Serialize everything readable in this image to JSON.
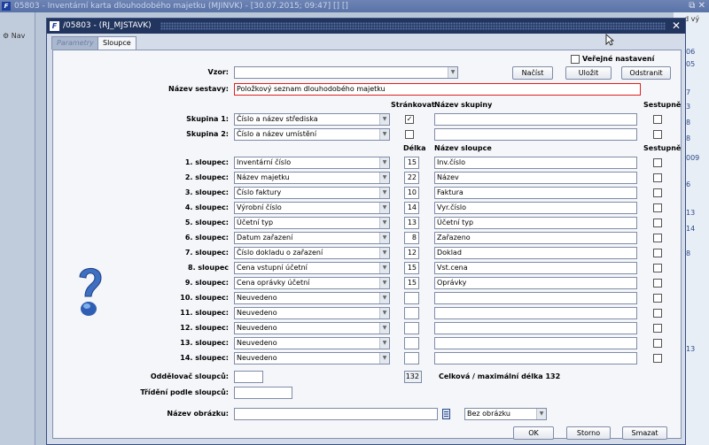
{
  "background": {
    "window_title": "05803 - Inventární karta dlouhodobého majetku (MJINVK) - [30.07.2015; 09:47] [] []",
    "nav_label": "Nav",
    "right_header": "d vý",
    "right_cells": [
      "06",
      "05",
      "7",
      "3",
      "8",
      "8",
      "009",
      "6",
      "13",
      "14",
      "8",
      "13"
    ]
  },
  "dialog": {
    "title": "/05803 - (RJ_MJSTAVK)",
    "tabs": [
      "Parametry",
      "Sloupce"
    ],
    "verejne_label": "Veřejné nastavení",
    "vzor_label": "Vzor:",
    "vzor_value": "",
    "buttons": {
      "nacist": "Načíst",
      "ulozit": "Uložit",
      "odstranit": "Odstranit",
      "ok": "OK",
      "storno": "Storno",
      "smazat": "Smazat"
    },
    "nazev_sestavy_label": "Název sestavy:",
    "nazev_sestavy_value": "Položkový seznam dlouhodobého majetku",
    "headers": {
      "strankovat": "Stránkovat",
      "nazev_skupiny": "Název skupiny",
      "sestupne": "Sestupně",
      "delka": "Délka",
      "nazev_sloupce": "Název sloupce",
      "sestupne2": "Sestupně"
    },
    "groups": [
      {
        "label": "Skupina 1:",
        "value": "Číslo a název střediska",
        "strankovat": true,
        "nazev": "",
        "sestupne": false
      },
      {
        "label": "Skupina 2:",
        "value": "Číslo a název umístění",
        "strankovat": false,
        "nazev": "",
        "sestupne": false
      }
    ],
    "columns": [
      {
        "label": "1. sloupec:",
        "value": "Inventární číslo",
        "delka": "15",
        "nazev": "Inv.číslo"
      },
      {
        "label": "2. sloupec:",
        "value": "Název majetku",
        "delka": "22",
        "nazev": "Název"
      },
      {
        "label": "3. sloupec:",
        "value": "Číslo faktury",
        "delka": "10",
        "nazev": "Faktura"
      },
      {
        "label": "4. sloupec:",
        "value": "Výrobní číslo",
        "delka": "14",
        "nazev": "Vyr.číslo"
      },
      {
        "label": "5. sloupec:",
        "value": "Účetní typ",
        "delka": "13",
        "nazev": "Účetní typ"
      },
      {
        "label": "6. sloupec:",
        "value": "Datum zařazení",
        "delka": "8",
        "nazev": "Zařazeno"
      },
      {
        "label": "7. sloupec:",
        "value": "Číslo dokladu o zařazení",
        "delka": "12",
        "nazev": "Doklad"
      },
      {
        "label": "8. sloupec",
        "value": "Cena vstupní účetní",
        "delka": "15",
        "nazev": "Vst.cena"
      },
      {
        "label": "9. sloupec:",
        "value": "Cena oprávky účetní",
        "delka": "15",
        "nazev": "Oprávky"
      },
      {
        "label": "10. sloupec:",
        "value": "Neuvedeno",
        "delka": "",
        "nazev": ""
      },
      {
        "label": "11. sloupec:",
        "value": "Neuvedeno",
        "delka": "",
        "nazev": ""
      },
      {
        "label": "12. sloupec:",
        "value": "Neuvedeno",
        "delka": "",
        "nazev": ""
      },
      {
        "label": "13. sloupec:",
        "value": "Neuvedeno",
        "delka": "",
        "nazev": ""
      },
      {
        "label": "14. sloupec:",
        "value": "Neuvedeno",
        "delka": "",
        "nazev": ""
      }
    ],
    "oddelovac_label": "Oddělovač sloupců:",
    "oddelovac_value": "",
    "total_value": "132",
    "total_label": "Celková / maximální délka 132",
    "trideni_label": "Třídění podle sloupců:",
    "trideni_value": "",
    "nazev_obrazku_label": "Název obrázku:",
    "nazev_obrazku_value": "",
    "obrazek_option": "Bez obrázku"
  }
}
